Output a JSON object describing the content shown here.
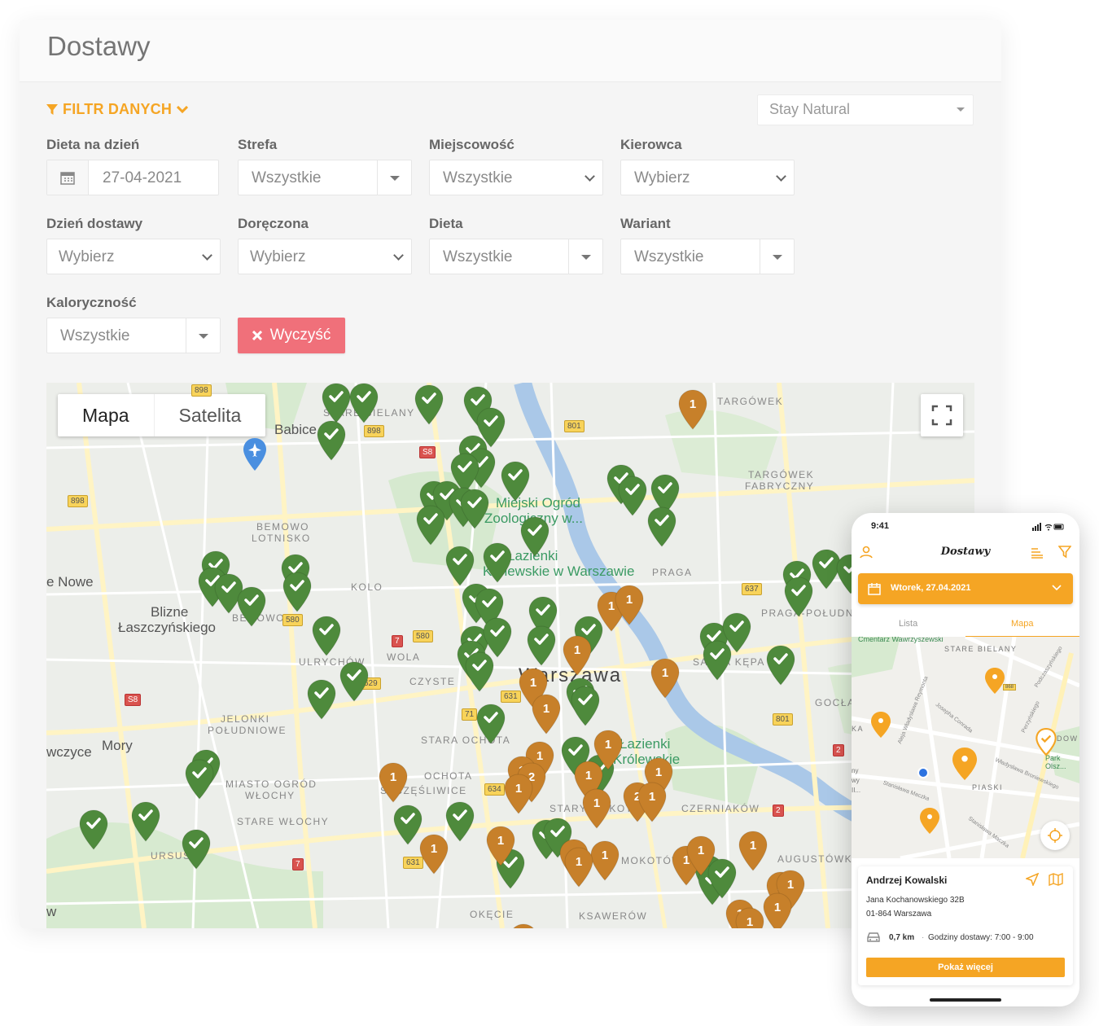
{
  "page": {
    "title": "Dostawy",
    "filter_toggle": "FILTR DANYCH",
    "brand_select": "Stay Natural"
  },
  "filters": {
    "diet_date": {
      "label": "Dieta na dzień",
      "value": "27-04-2021"
    },
    "zone": {
      "label": "Strefa",
      "value": "Wszystkie"
    },
    "city": {
      "label": "Miejscowość",
      "value": "Wszystkie"
    },
    "driver": {
      "label": "Kierowca",
      "value": "Wybierz"
    },
    "delivery_day": {
      "label": "Dzień dostawy",
      "value": "Wybierz"
    },
    "delivered": {
      "label": "Doręczona",
      "value": "Wybierz"
    },
    "diet": {
      "label": "Dieta",
      "value": "Wszystkie"
    },
    "variant": {
      "label": "Wariant",
      "value": "Wszystkie"
    },
    "calories": {
      "label": "Kaloryczność",
      "value": "Wszystkie"
    },
    "clear_label": "Wyczyść"
  },
  "map": {
    "tabs": [
      "Mapa",
      "Satelita"
    ],
    "labels": {
      "stare_bielany": "STARE BIELANY",
      "targowek": "TARGÓWEK",
      "targowek_fabryczny_1": "TARGÓWEK",
      "targowek_fabryczny_2": "FABRYCZNY",
      "bemowo_1": "BEMOWO",
      "bemowo_2": "LOTNISKO",
      "zoo_1": "Miejski Ogród",
      "zoo_2": "Zoologiczny w...",
      "lazienki_k_1": "Łazienki",
      "lazienki_k_2": "Królewskie w Warszawie",
      "praga": "PRAGA",
      "kolo": "KOLO",
      "nowe": "e Nowe",
      "blizne_1": "Blizne",
      "blizne_2": "Łaszczyńskiego",
      "bemowo": "BEMOWO",
      "wola": "WOLA",
      "ulrychow": "ULRYCHÓW",
      "czyste": "CZYSTE",
      "warszawa": "Warszawa",
      "praga_poludnie": "PRAGA-POŁUDNIE",
      "saska_kepa": "SASKA KĘPA",
      "gocla": "GOCŁA",
      "jelonki_1": "JELONKI",
      "jelonki_2": "POŁUDNIOWE",
      "stara_ochota": "STARA OCHOTA",
      "lazienki_1": "Łazienki",
      "lazienki_2": "Królewskie",
      "ochota": "OCHOTA",
      "szczesliwice": "SZCZĘŚLIWICE",
      "wczyce": "wczyce",
      "mory": "Mory",
      "miasto_ogrod_1": "MIASTO OGRÓD",
      "miasto_ogrod_2": "WŁOCHY",
      "stare_wlochy": "STARE WŁOCHY",
      "czerniakow": "CZERNIAKÓW",
      "ursus": "URSUS",
      "mokotow": "MOKOTÓW",
      "augustowka": "AUGUSTÓWKA",
      "okecie": "OKĘCIE",
      "ksawerow": "KSAWERÓW",
      "babice": "Babice",
      "stary_mokotow": "STARY MOKOTÓW",
      "w": "w"
    },
    "badges": {
      "b898a": "898",
      "b898b": "898",
      "b898c": "898",
      "bs8a": "S8",
      "bs8b": "S8",
      "b801a": "801",
      "b801b": "801",
      "b580a": "580",
      "b580b": "580",
      "b7a": "7",
      "b7b": "7",
      "b631a": "631",
      "b631b": "631",
      "b634": "634",
      "b637": "637",
      "b2a": "2",
      "b2b": "2",
      "b629": "629",
      "b71": "71"
    },
    "pins_green_count": 66,
    "pins_orange_count": 38,
    "colors": {
      "green_pin": "#4e8a3c",
      "orange_pin": "#c7802a"
    }
  },
  "phone": {
    "time": "9:41",
    "title": "Dostawy",
    "date": "Wtorek, 27.04.2021",
    "tabs": [
      "Lista",
      "Mapa"
    ],
    "map_labels": {
      "cmentarz": "Cmentarz Wawrzyszewski",
      "stare_bielany": "STARE BIELANY",
      "piaski": "PIASKI",
      "park": "Park Olsz...",
      "dow": "DOW",
      "ka": "KA",
      "bronowska": "Władysława Broniewskiego",
      "maczka": "Stanisława Maczka",
      "reymonta": "Aleja Władysława Reymonta",
      "conrada": "Josepha Conrada",
      "podczaszynskiego": "Podczaszyńskiego",
      "perzynskiego": "Perzyńskiego",
      "my": "ny",
      "wy": "wy",
      "ii": "II...",
      "b868": "868"
    },
    "card": {
      "name": "Andrzej Kowalski",
      "address_1": "Jana Kochanowskiego 32B",
      "address_2": "01-864 Warszawa",
      "distance": "0,7 km",
      "hours": "Godziny dostawy: 7:00 - 9:00",
      "more": "Pokaż więcej"
    },
    "accent": "#f5a524"
  }
}
